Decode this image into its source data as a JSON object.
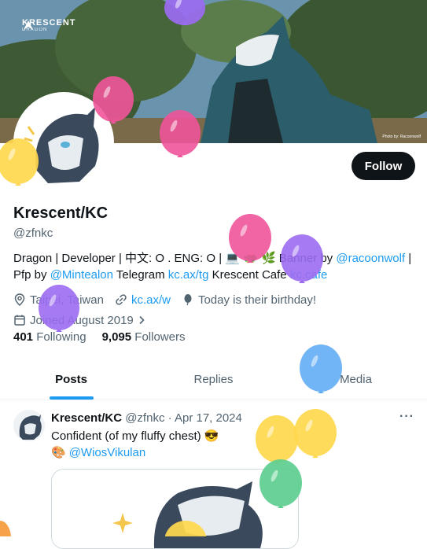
{
  "banner": {
    "brand_name": "KRESCENT",
    "brand_sub": "DRAGON",
    "photo_credit": "Photo by: Racoonwolf"
  },
  "profile": {
    "follow_label": "Follow",
    "display_name": "Krescent/KC",
    "handle": "@zfnkc",
    "bio": {
      "line1_text": "Dragon | Developer | 中文: O . ENG: O | 💻 🐲 🌿 Banner by ",
      "line1_mention": "@racoonwolf",
      "line1_end": " |",
      "line2_prefix": "Pfp by ",
      "line2_mention": "@Mintealon",
      "line2_mid": " Telegram ",
      "line2_link1": "kc.ax/tg",
      "line2_mid2": " Krescent Cafe ",
      "line2_link2": "kc.cafe"
    },
    "location": "Taipei, Taiwan",
    "website": "kc.ax/w",
    "birthday": "Today is their birthday!",
    "joined": "Joined August 2019",
    "following_count": "401",
    "following_label": "Following",
    "followers_count": "9,095",
    "followers_label": "Followers"
  },
  "tabs": [
    {
      "label": "Posts",
      "active": true
    },
    {
      "label": "Replies",
      "active": false
    },
    {
      "label": "Media",
      "active": false
    }
  ],
  "tweet": {
    "author": "Krescent/KC",
    "handle": "@zfnkc",
    "separator": "·",
    "date": "Apr 17, 2024",
    "more": "···",
    "text": "Confident (of my fluffy chest) 😎",
    "mention_emoji": "🎨",
    "mention": "@WiosVikulan"
  },
  "colors": {
    "accent": "#1d9bf0",
    "text": "#0f1419",
    "muted": "#536471",
    "balloon_purple": "#9b6bf2",
    "balloon_pink": "#f0549a",
    "balloon_yellow": "#ffd84d",
    "balloon_blue": "#62adf5",
    "balloon_green": "#5dce8f"
  },
  "icons": [
    "location-pin-icon",
    "link-icon",
    "balloon-icon",
    "calendar-icon",
    "chevron-right-icon",
    "more-icon"
  ]
}
